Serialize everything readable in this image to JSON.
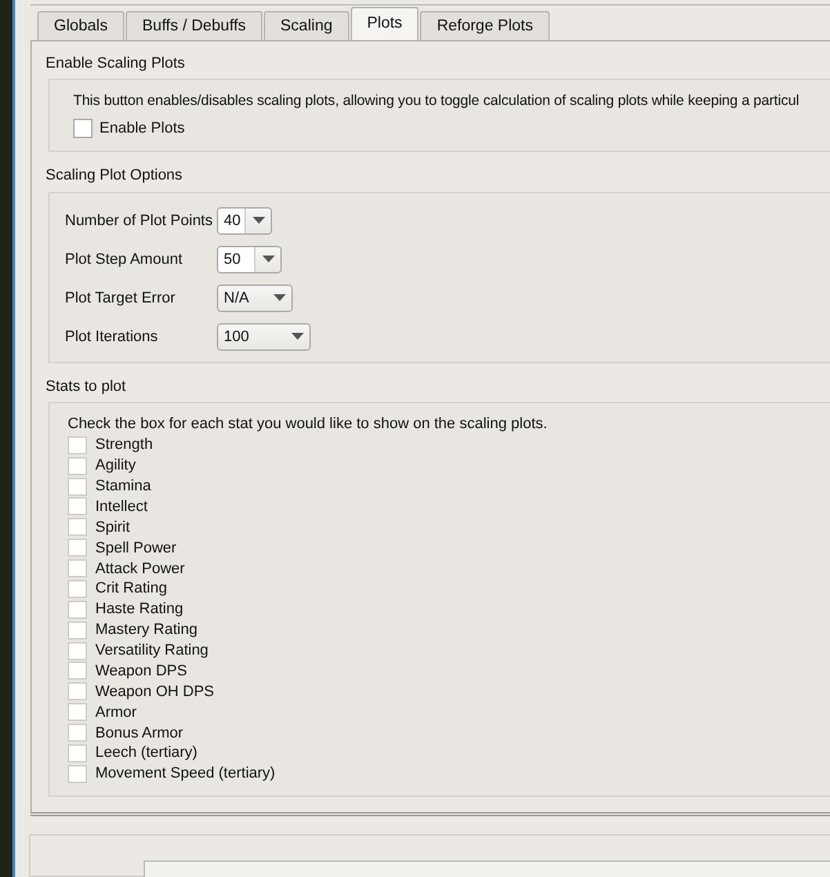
{
  "tabs": [
    {
      "label": "Globals",
      "selected": false
    },
    {
      "label": "Buffs / Debuffs",
      "selected": false
    },
    {
      "label": "Scaling",
      "selected": false
    },
    {
      "label": "Plots",
      "selected": true
    },
    {
      "label": "Reforge Plots",
      "selected": false
    }
  ],
  "enable_section": {
    "title": "Enable Scaling Plots",
    "description": "This button enables/disables scaling plots, allowing you to toggle calculation of scaling plots while keeping a particul",
    "checkbox": {
      "label": "Enable Plots",
      "checked": false
    }
  },
  "options_section": {
    "title": "Scaling Plot Options",
    "fields": [
      {
        "label": "Number of Plot Points",
        "value": "40"
      },
      {
        "label": "Plot Step Amount",
        "value": "50"
      },
      {
        "label": "Plot Target Error",
        "value": "N/A"
      },
      {
        "label": "Plot Iterations",
        "value": "100"
      }
    ]
  },
  "stats_section": {
    "title": "Stats to plot",
    "description": "Check the box for each stat you would like to show on the scaling plots.",
    "stats": [
      {
        "label": "Strength",
        "checked": false
      },
      {
        "label": "Agility",
        "checked": false
      },
      {
        "label": "Stamina",
        "checked": false
      },
      {
        "label": "Intellect",
        "checked": false
      },
      {
        "label": "Spirit",
        "checked": false
      },
      {
        "label": "Spell Power",
        "checked": false
      },
      {
        "label": "Attack Power",
        "checked": false
      },
      {
        "label": "Crit Rating",
        "checked": false
      },
      {
        "label": "Haste Rating",
        "checked": false
      },
      {
        "label": "Mastery Rating",
        "checked": false
      },
      {
        "label": "Versatility Rating",
        "checked": false
      },
      {
        "label": "Weapon DPS",
        "checked": false
      },
      {
        "label": "Weapon OH DPS",
        "checked": false
      },
      {
        "label": "Armor",
        "checked": false
      },
      {
        "label": "Bonus Armor",
        "checked": false
      },
      {
        "label": "Leech (tertiary)",
        "checked": false
      },
      {
        "label": "Movement Speed (tertiary)",
        "checked": false
      }
    ]
  }
}
